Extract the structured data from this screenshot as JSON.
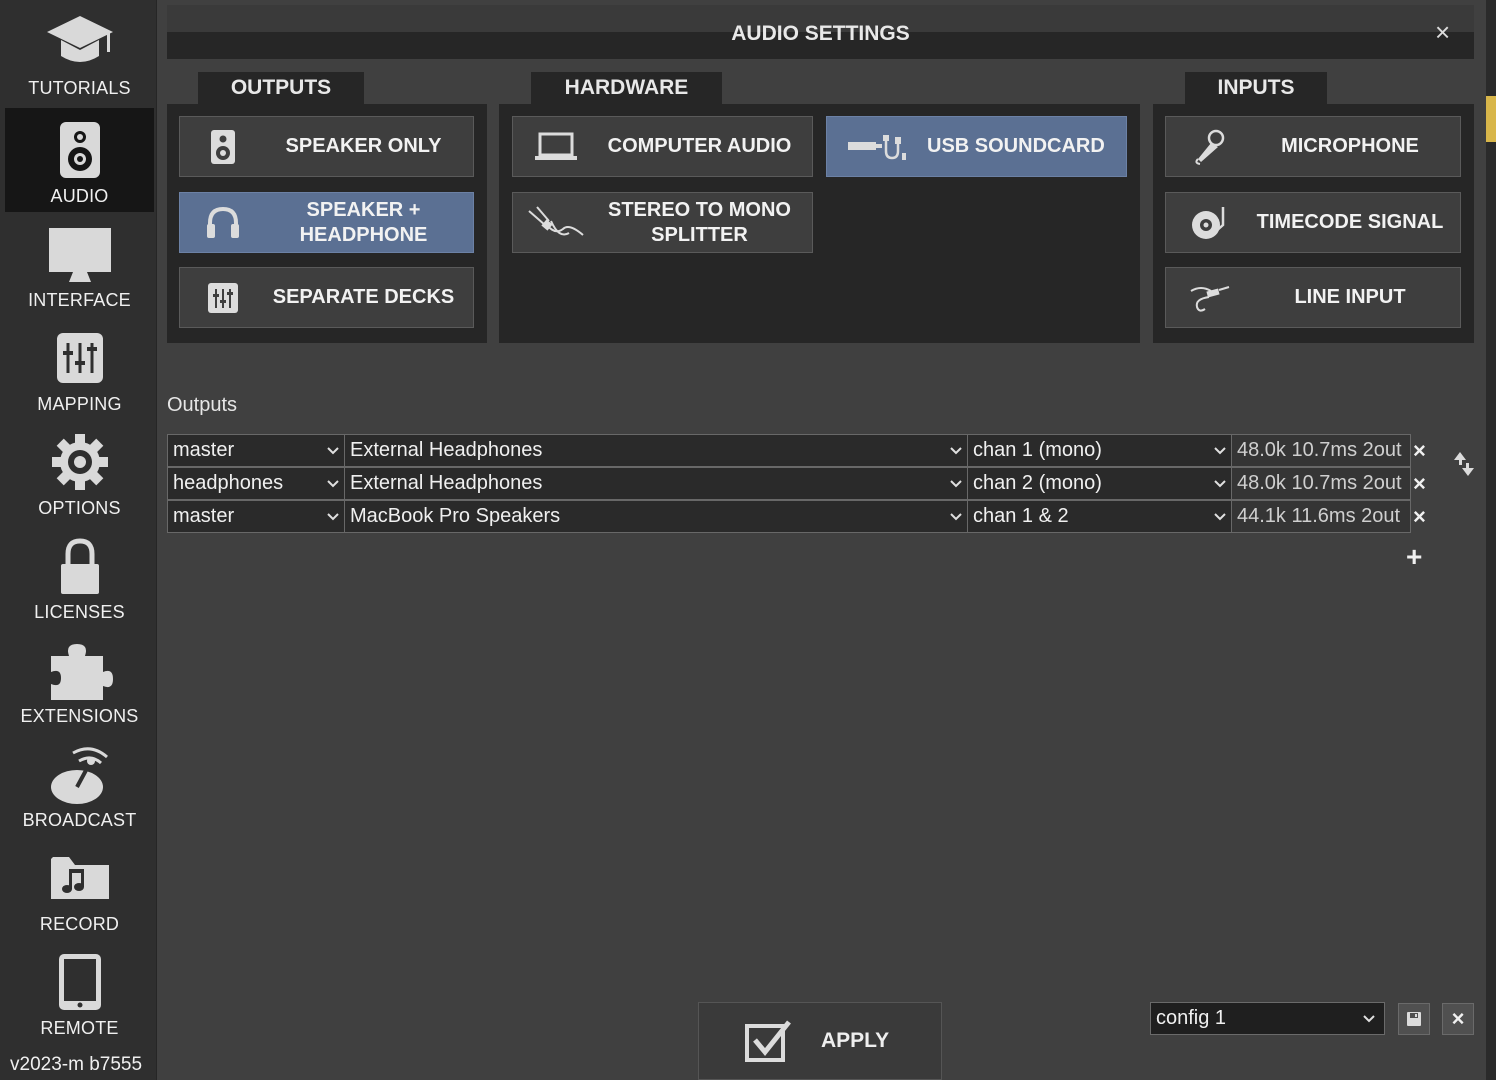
{
  "sidebar": {
    "items": [
      {
        "label": "TUTORIALS",
        "icon": "graduation-cap-icon"
      },
      {
        "label": "AUDIO",
        "icon": "speaker-icon",
        "active": true
      },
      {
        "label": "INTERFACE",
        "icon": "monitor-icon"
      },
      {
        "label": "MAPPING",
        "icon": "mixer-sliders-icon"
      },
      {
        "label": "OPTIONS",
        "icon": "gear-icon"
      },
      {
        "label": "LICENSES",
        "icon": "lock-icon"
      },
      {
        "label": "EXTENSIONS",
        "icon": "puzzle-icon"
      },
      {
        "label": "BROADCAST",
        "icon": "satellite-dish-icon"
      },
      {
        "label": "RECORD",
        "icon": "music-folder-icon"
      },
      {
        "label": "REMOTE",
        "icon": "tablet-icon"
      }
    ],
    "version": "v2023-m b7555"
  },
  "dialog": {
    "title": "AUDIO SETTINGS",
    "close": "×"
  },
  "outputs_panel": {
    "tab": "OUTPUTS",
    "buttons": [
      {
        "label": "SPEAKER ONLY",
        "icon": "speaker-icon",
        "selected": false
      },
      {
        "label": "SPEAKER +\nHEADPHONE",
        "icon": "headphones-icon",
        "selected": true
      },
      {
        "label": "SEPARATE DECKS",
        "icon": "mixer-icon",
        "selected": false
      }
    ]
  },
  "hardware_panel": {
    "tab": "HARDWARE",
    "buttons": [
      {
        "label": "COMPUTER AUDIO",
        "icon": "laptop-icon",
        "selected": false
      },
      {
        "label": "USB SOUNDCARD",
        "icon": "usb-soundcard-icon",
        "selected": true
      },
      {
        "label": "STEREO TO MONO\nSPLITTER",
        "icon": "splitter-cable-icon",
        "selected": false
      }
    ]
  },
  "inputs_panel": {
    "tab": "INPUTS",
    "buttons": [
      {
        "label": "MICROPHONE",
        "icon": "microphone-icon",
        "selected": false
      },
      {
        "label": "TIMECODE SIGNAL",
        "icon": "turntable-icon",
        "selected": false
      },
      {
        "label": "LINE INPUT",
        "icon": "jack-cable-icon",
        "selected": false
      }
    ]
  },
  "outputs_table": {
    "label": "Outputs",
    "rows": [
      {
        "output": "master",
        "device": "External Headphones",
        "channel": "chan 1 (mono)",
        "info": "48.0k 10.7ms 2out"
      },
      {
        "output": "headphones",
        "device": "External Headphones",
        "channel": "chan 2 (mono)",
        "info": "48.0k 10.7ms 2out"
      },
      {
        "output": "master",
        "device": "MacBook Pro Speakers",
        "channel": "chan 1 & 2",
        "info": "44.1k 11.6ms 2out"
      }
    ],
    "remove_symbol": "×",
    "add_symbol": "+"
  },
  "footer": {
    "apply_label": "APPLY",
    "config_value": "config 1",
    "save_icon": "floppy-disk-icon",
    "delete_symbol": "×"
  },
  "colors": {
    "selected": "#5b7093",
    "panel": "#262626",
    "background": "#404040",
    "sidebar": "#2f2f2f"
  }
}
